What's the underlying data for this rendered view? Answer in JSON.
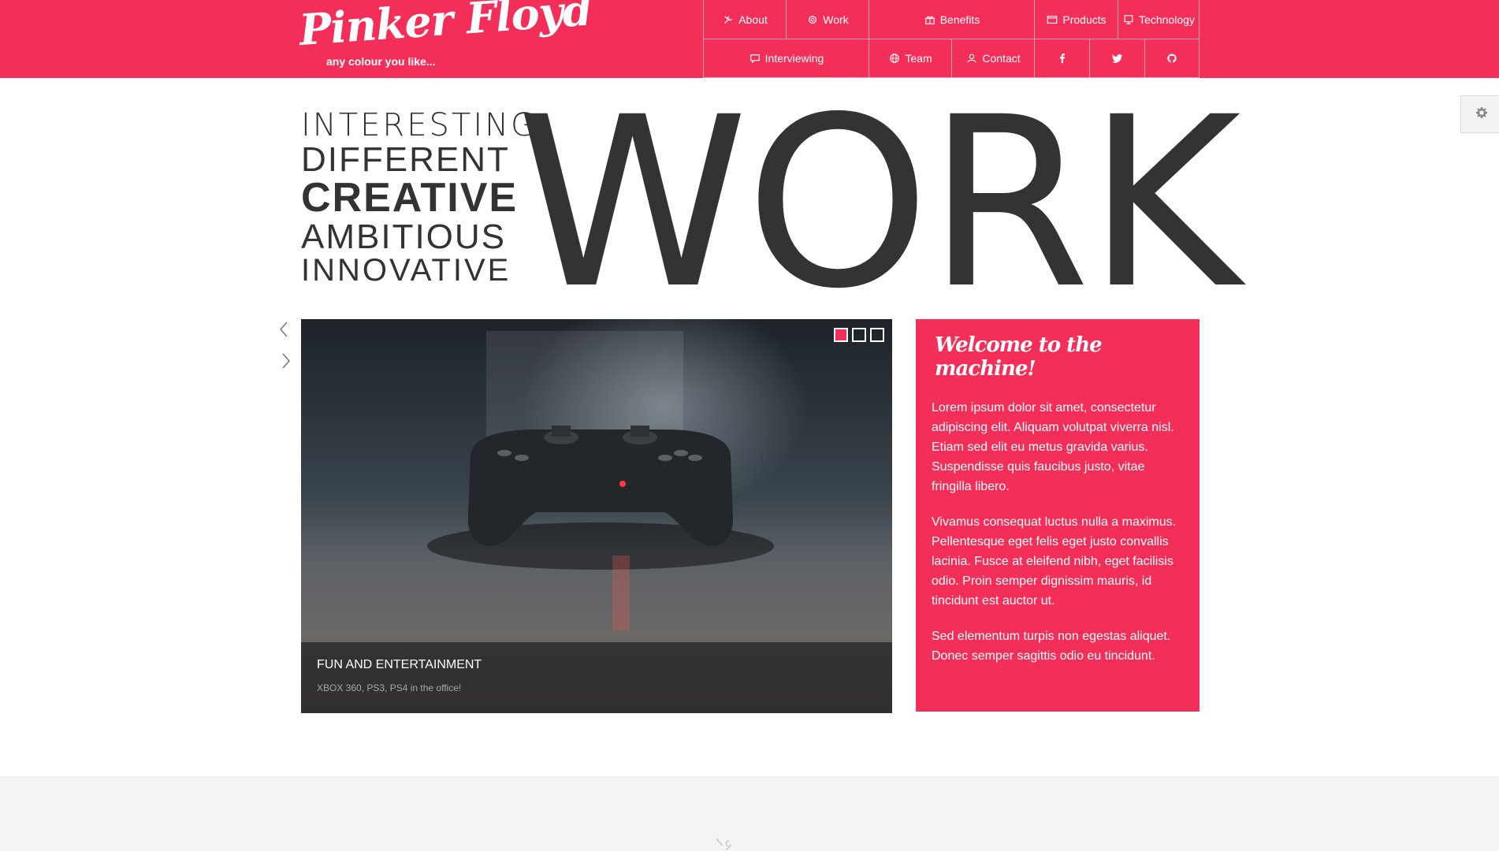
{
  "brand": {
    "title": "Pinker Floyd",
    "tagline": "any colour you like...",
    "accent_color": "#f32e58"
  },
  "nav": {
    "row1": [
      {
        "label": "About",
        "icon": "wrench-icon"
      },
      {
        "label": "Work",
        "icon": "gear-icon"
      },
      {
        "label": "Benefits",
        "icon": "gift-icon"
      },
      {
        "label": "Products",
        "icon": "window-icon"
      },
      {
        "label": "Technology",
        "icon": "monitor-icon"
      }
    ],
    "row2": [
      {
        "label": "Interviewing",
        "icon": "chat-icon"
      },
      {
        "label": "Team",
        "icon": "globe-icon"
      },
      {
        "label": "Contact",
        "icon": "user-icon"
      }
    ],
    "social": [
      {
        "icon": "facebook-icon"
      },
      {
        "icon": "twitter-icon"
      },
      {
        "icon": "github-icon"
      }
    ]
  },
  "settings": {
    "icon": "gear-icon"
  },
  "hero": {
    "words": [
      "INTERESTING",
      "DIFFERENT",
      "CREATIVE",
      "AMBITIOUS",
      "INNOVATIVE"
    ],
    "big_word": "WORK"
  },
  "slider": {
    "prev_icon": "chevron-left-icon",
    "next_icon": "chevron-right-icon",
    "caption_title": "FUN AND ENTERTAINMENT",
    "caption_subtitle": "XBOX 360, PS3, PS4 in the office!",
    "slide_count": 3,
    "active_slide": 1
  },
  "welcome": {
    "title": "Welcome to the machine!",
    "paragraphs": [
      "Lorem ipsum dolor sit amet, consectetur adipiscing elit. Aliquam volutpat viverra nisl. Etiam sed elit eu metus gravida varius. Suspendisse quis faucibus justo, vitae fringilla libero.",
      "Vivamus consequat luctus nulla a maximus. Pellentesque eget felis eget justo convallis lacinia. Fusce at eleifend nibh, eget facilisis odio. Proin semper dignissim mauris, id tincidunt est auctor ut.",
      "Sed elementum turpis non egestas aliquet. Donec semper sagittis odio eu tincidunt."
    ]
  },
  "footer": {
    "icon": "tools-icon"
  }
}
